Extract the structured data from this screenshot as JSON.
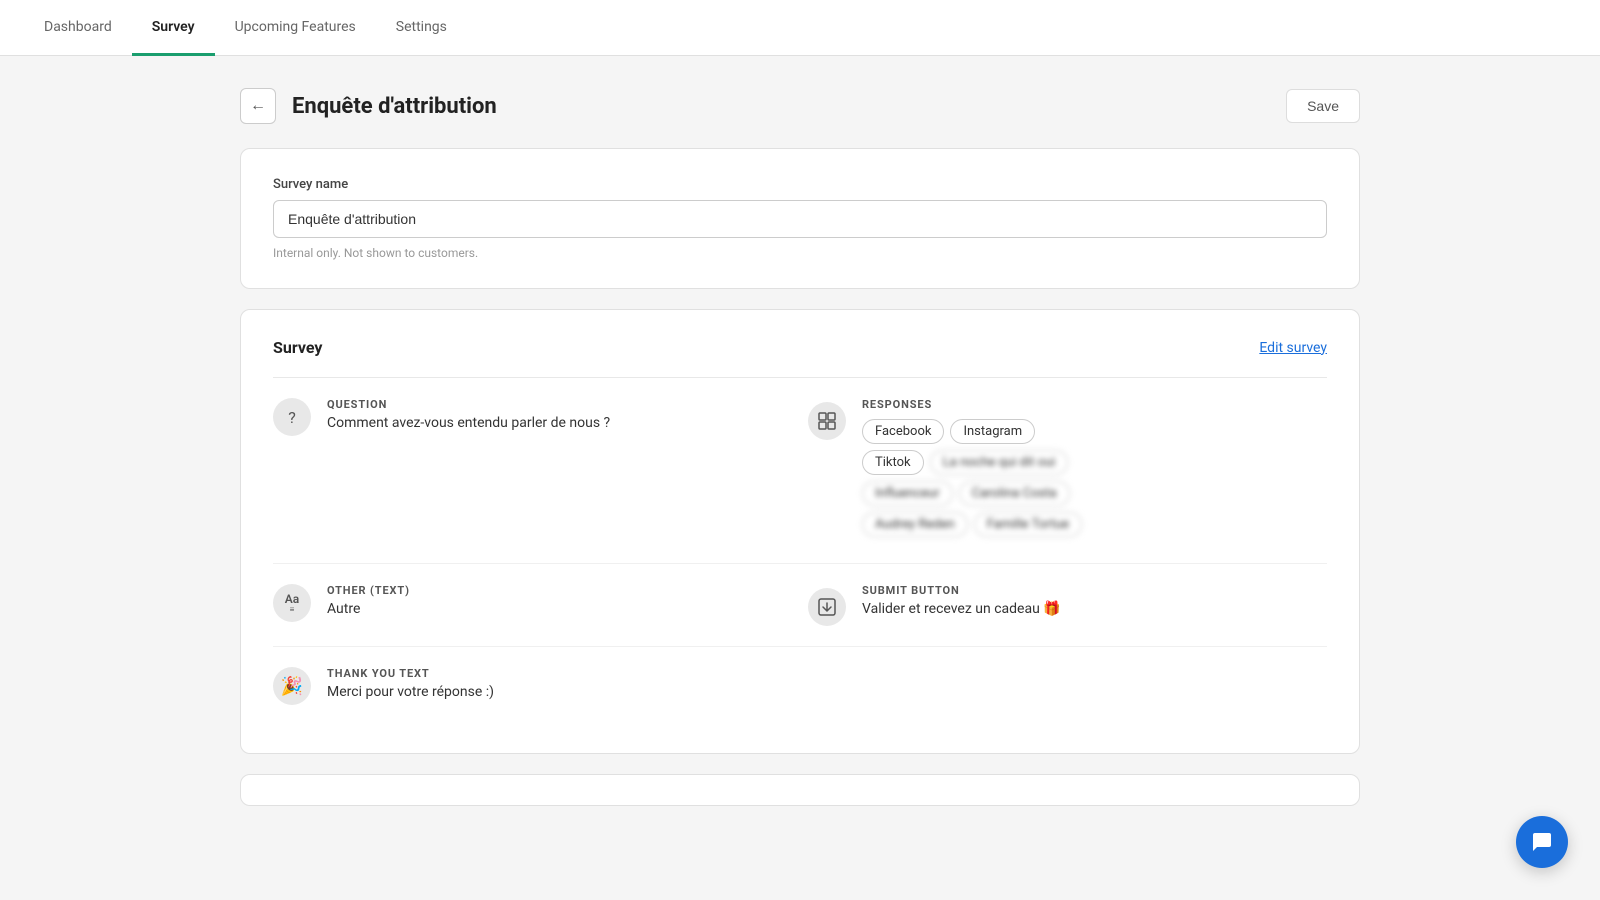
{
  "nav": {
    "tabs": [
      {
        "id": "dashboard",
        "label": "Dashboard",
        "active": false
      },
      {
        "id": "survey",
        "label": "Survey",
        "active": true
      },
      {
        "id": "upcoming-features",
        "label": "Upcoming Features",
        "active": false
      },
      {
        "id": "settings",
        "label": "Settings",
        "active": false
      }
    ]
  },
  "page": {
    "back_button_icon": "←",
    "title": "Enquête d'attribution",
    "save_label": "Save"
  },
  "survey_name_card": {
    "field_label": "Survey name",
    "field_value": "Enquête d'attribution",
    "field_hint": "Internal only. Not shown to customers."
  },
  "survey_card": {
    "title": "Survey",
    "edit_link": "Edit survey",
    "rows": [
      {
        "id": "question-row",
        "icon": "?",
        "type_label": "QUESTION",
        "value": "Comment avez-vous entendu parler de nous ?",
        "has_middle_icon": true,
        "middle_icon": "⊞",
        "has_responses": true,
        "responses_label": "RESPONSES",
        "tags": [
          {
            "text": "Facebook",
            "blurred": false
          },
          {
            "text": "Instagram",
            "blurred": false
          },
          {
            "text": "Tiktok",
            "blurred": false
          },
          {
            "text": "La noche qui dit oui",
            "blurred": true
          },
          {
            "text": "Influenceur",
            "blurred": true
          },
          {
            "text": "Carolina Costa",
            "blurred": true
          },
          {
            "text": "Audrey Reden",
            "blurred": true
          },
          {
            "text": "Famille Tortue",
            "blurred": true
          }
        ]
      },
      {
        "id": "other-row",
        "icon": "Aa",
        "type_label": "OTHER (TEXT)",
        "value": "Autre",
        "has_middle_icon": true,
        "middle_icon": "⬇",
        "has_responses": false,
        "submit_label": "SUBMIT BUTTON",
        "submit_value": "Valider et recevez un cadeau 🎁"
      },
      {
        "id": "thankyou-row",
        "icon": "🎉",
        "type_label": "THANK YOU TEXT",
        "value": "Merci pour votre réponse :)",
        "has_middle_icon": false,
        "has_responses": false
      }
    ]
  },
  "fab": {
    "icon": "💬"
  }
}
